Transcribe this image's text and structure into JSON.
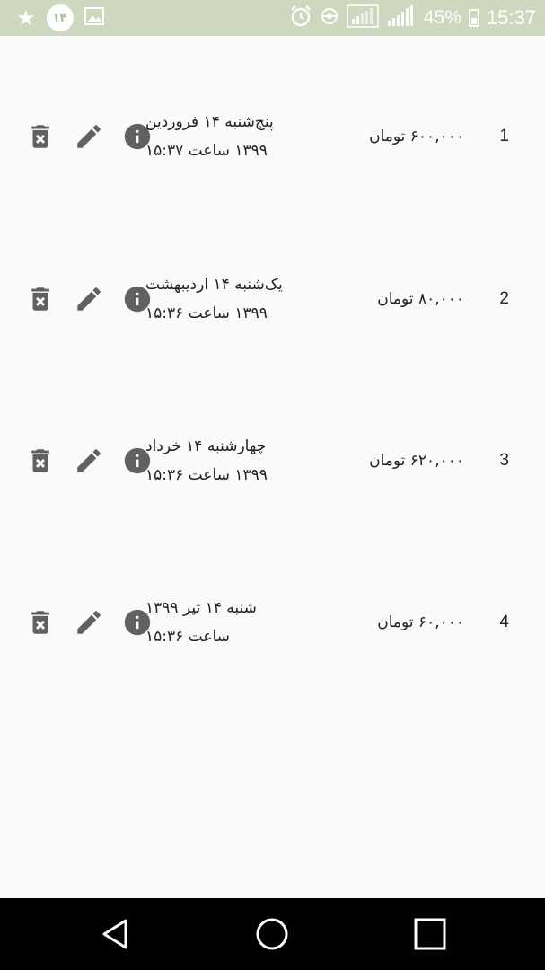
{
  "status_bar": {
    "notification_badge": "۱۴",
    "battery_percent": "45%",
    "time": "15:37"
  },
  "items": [
    {
      "index": "1",
      "price": "۶۰۰,۰۰۰ تومان",
      "date_line1": "پنج‌شنبه ۱۴ فروردین",
      "date_line2": "۱۳۹۹ ساعت ۱۵:۳۷"
    },
    {
      "index": "2",
      "price": "۸۰,۰۰۰ تومان",
      "date_line1": "یک‌شنبه ۱۴ اردیبهشت",
      "date_line2": "۱۳۹۹ ساعت ۱۵:۳۶"
    },
    {
      "index": "3",
      "price": "۶۲۰,۰۰۰ تومان",
      "date_line1": "چهارشنبه ۱۴ خرداد",
      "date_line2": "۱۳۹۹ ساعت ۱۵:۳۶"
    },
    {
      "index": "4",
      "price": "۶۰,۰۰۰ تومان",
      "date_line1": "شنبه ۱۴ تیر ۱۳۹۹",
      "date_line2": "ساعت ۱۵:۳۶"
    }
  ],
  "icons": {
    "delete": "delete-forever-icon",
    "edit": "pencil-icon",
    "info": "info-icon"
  },
  "colors": {
    "status_bar": "#cdd8bf",
    "icon": "#616161",
    "background": "#fafafa"
  }
}
